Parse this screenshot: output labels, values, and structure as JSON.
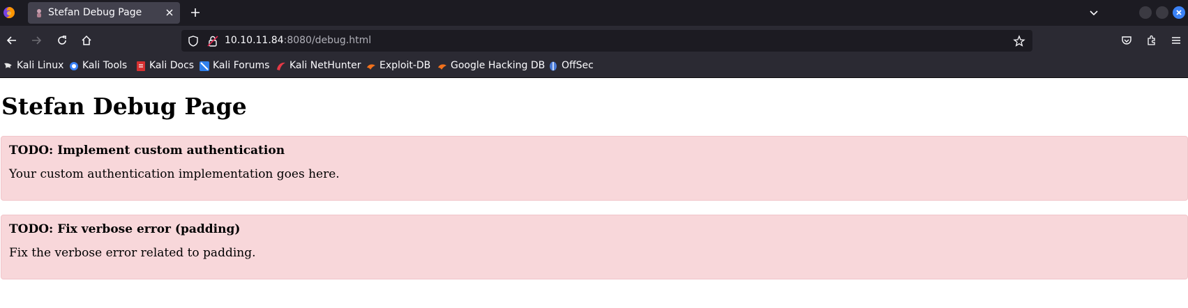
{
  "browser": {
    "tab": {
      "title": "Stefan Debug Page"
    },
    "address": {
      "host": "10.10.11.84",
      "rest": ":8080/debug.html"
    },
    "bookmarks": [
      {
        "label": "Kali Linux",
        "icon": "kali-dragon-icon",
        "color": "#e8e8e8"
      },
      {
        "label": "Kali Tools",
        "icon": "kali-tools-icon",
        "color": "#3b82f6"
      },
      {
        "label": "Kali Docs",
        "icon": "kali-docs-icon",
        "color": "#d63031"
      },
      {
        "label": "Kali Forums",
        "icon": "kali-forums-icon",
        "color": "#2f80ed"
      },
      {
        "label": "Kali NetHunter",
        "icon": "kali-nethunter-icon",
        "color": "#e63946"
      },
      {
        "label": "Exploit-DB",
        "icon": "exploit-db-icon",
        "color": "#f2711c"
      },
      {
        "label": "Google Hacking DB",
        "icon": "google-hacking-db-icon",
        "color": "#f2711c"
      },
      {
        "label": "OffSec",
        "icon": "offsec-icon",
        "color": "#4a7bd8"
      }
    ]
  },
  "page": {
    "title": "Stefan Debug Page",
    "todos": [
      {
        "heading": "TODO: Implement custom authentication",
        "text": "Your custom authentication implementation goes here."
      },
      {
        "heading": "TODO: Fix verbose error (padding)",
        "text": "Fix the verbose error related to padding."
      }
    ]
  },
  "colors": {
    "alert_background": "#f8d7da",
    "alert_border": "#f1c5ca",
    "chrome_dark": "#1c1b22",
    "chrome_toolbar": "#2b2a33"
  }
}
